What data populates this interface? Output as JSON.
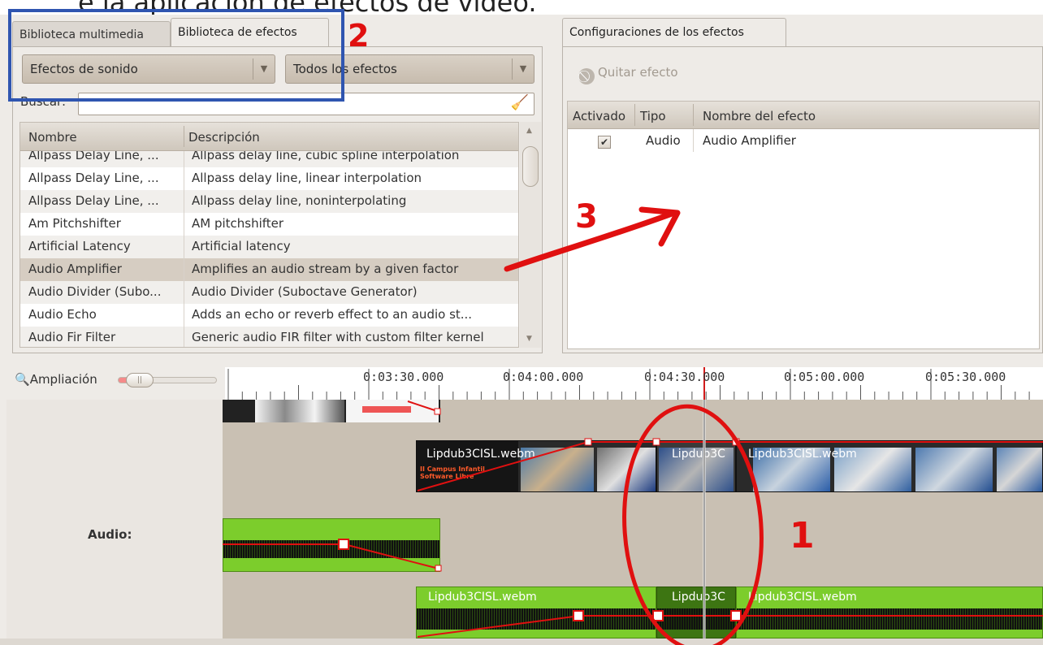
{
  "header_text": "e la aplicación de efectos de vídeo.",
  "left_tabs": [
    {
      "label": "Biblioteca multimedia"
    },
    {
      "label": "Biblioteca de efectos"
    }
  ],
  "category_combo": {
    "value": "Efectos de sonido"
  },
  "filter_combo": {
    "value": "Todos los efectos"
  },
  "search": {
    "label": "Buscar:",
    "value": ""
  },
  "effects_list": {
    "columns": [
      "Nombre",
      "Descripción"
    ],
    "rows": [
      {
        "name": "Allpass Delay Line, ...",
        "description": "Allpass delay line, cubic spline interpolation"
      },
      {
        "name": "Allpass Delay Line, ...",
        "description": "Allpass delay line, linear interpolation"
      },
      {
        "name": "Allpass Delay Line, ...",
        "description": "Allpass delay line, noninterpolating"
      },
      {
        "name": "Am Pitchshifter",
        "description": "AM pitchshifter"
      },
      {
        "name": "Artificial Latency",
        "description": "Artificial latency"
      },
      {
        "name": "Audio Amplifier",
        "description": "Amplifies an audio stream by a given factor"
      },
      {
        "name": "Audio Divider (Subo...",
        "description": "Audio Divider (Suboctave Generator)"
      },
      {
        "name": "Audio Echo",
        "description": "Adds an echo or reverb effect to an audio st..."
      },
      {
        "name": "Audio Fir Filter",
        "description": "Generic audio FIR filter with custom filter kernel"
      }
    ],
    "selected_index": 5
  },
  "right_tab": {
    "label": "Configuraciones de los efectos"
  },
  "remove_button": {
    "label": "Quitar efecto"
  },
  "applied_effects": {
    "columns": [
      "Activado",
      "Tipo",
      "Nombre del efecto"
    ],
    "rows": [
      {
        "active": true,
        "type": "Audio",
        "name": "Audio Amplifier"
      }
    ]
  },
  "timeline": {
    "zoom_label": "Ampliación",
    "ruler_labels": [
      "0:03:30.000",
      "0:04:00.000",
      "0:04:30.000",
      "0:05:00.000",
      "0:05:30.000"
    ],
    "audio_track_label": "Audio:",
    "clip_names": {
      "video1": "Lipdub3CISL.webm",
      "video2": "Lipdub3C",
      "video3": "Lipdub3CISL.webm",
      "audio1": "Lipdub3CISL.webm",
      "audio2": "Lipdub3C",
      "audio3": "Lipdub3CISL.webm"
    },
    "thumb_text": "II Campus Infantil\nSoftware Libre"
  },
  "annotations": {
    "n1": "1",
    "n2": "2",
    "n3": "3"
  },
  "colors": {
    "annotation_red": "#e01010",
    "annotation_blue": "#2f55b0",
    "audio_clip_green": "#7ccd2c",
    "playhead": "#d21b1b"
  }
}
